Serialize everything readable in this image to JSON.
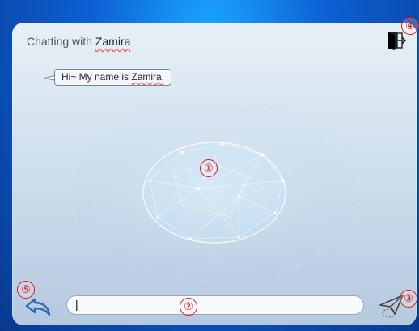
{
  "header": {
    "title_prefix": "Chatting with",
    "title_name": "Zamira"
  },
  "message": {
    "text_prefix": "Hi~ My name is",
    "text_name": "Zamira."
  },
  "input": {
    "value": "",
    "cursor": "|"
  },
  "markers": [
    "①",
    "②",
    "③",
    "④",
    "⑤"
  ],
  "icons": {
    "exit": "exit-door-icon",
    "back": "back-arrow-icon",
    "send": "send-paper-plane-icon"
  },
  "colors": {
    "marker": "#ee1111",
    "accent": "#2b6cb0"
  }
}
